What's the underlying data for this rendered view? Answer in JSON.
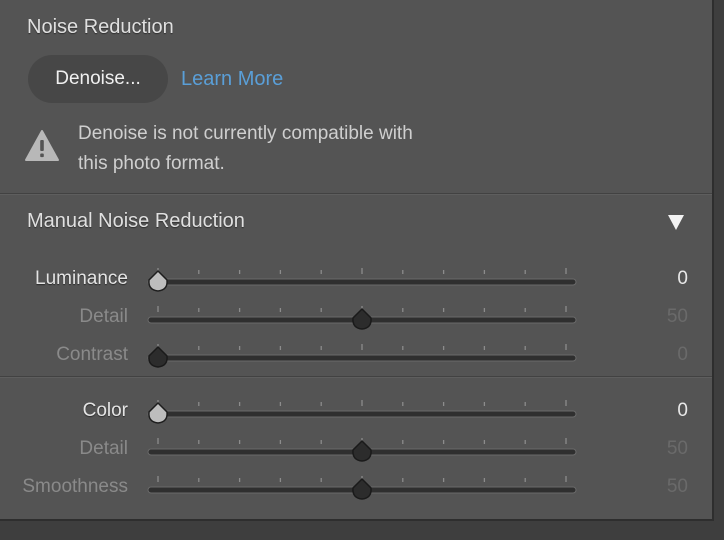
{
  "noise_reduction": {
    "title": "Noise Reduction",
    "denoise_button": "Denoise...",
    "learn_more": "Learn More",
    "warning_line1": "Denoise is not currently compatible with",
    "warning_line2": "this photo format."
  },
  "manual": {
    "title": "Manual Noise Reduction",
    "luminance_group": [
      {
        "label": "Luminance",
        "value": "0",
        "fraction": 0.0,
        "enabled": true
      },
      {
        "label": "Detail",
        "value": "50",
        "fraction": 0.5,
        "enabled": false
      },
      {
        "label": "Contrast",
        "value": "0",
        "fraction": 0.0,
        "enabled": false
      }
    ],
    "color_group": [
      {
        "label": "Color",
        "value": "0",
        "fraction": 0.0,
        "enabled": true
      },
      {
        "label": "Detail",
        "value": "50",
        "fraction": 0.5,
        "enabled": false
      },
      {
        "label": "Smoothness",
        "value": "50",
        "fraction": 0.5,
        "enabled": false
      }
    ]
  },
  "colors": {
    "panel_bg": "#545454",
    "link": "#5a9fd8",
    "text_active": "#e4e4e4",
    "text_dim": "#8a8a8a"
  },
  "icons": {
    "warning": "warning-triangle-icon",
    "collapse": "disclosure-triangle-icon",
    "thumb": "slider-thumb-icon"
  }
}
